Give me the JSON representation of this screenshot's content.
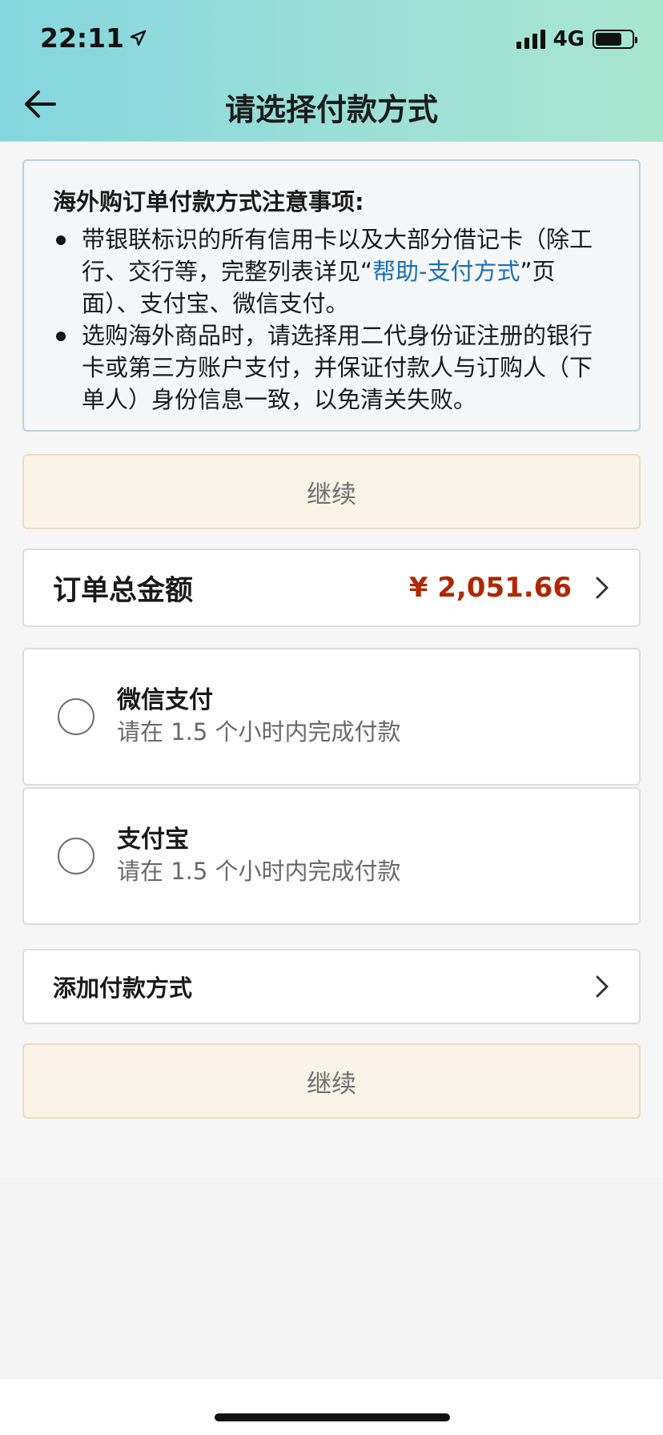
{
  "status_bar": {
    "time": "22:11",
    "network": "4G"
  },
  "header": {
    "title": "请选择付款方式"
  },
  "notice": {
    "title": "海外购订单付款方式注意事项:",
    "item1_before": "带银联标识的所有信用卡以及大部分借记卡（除工行、交行等，完整列表详见“",
    "item1_link": "帮助-支付方式",
    "item1_after": "”页面）、支付宝、微信支付。",
    "item2": "选购海外商品时，请选择用二代身份证注册的银行卡或第三方账户支付，并保证付款人与订购人（下单人）身份信息一致，以免清关失败。"
  },
  "continue_label": "继续",
  "order_total": {
    "label": "订单总金额",
    "amount": "¥  2,051.66"
  },
  "payment_options": [
    {
      "name": "微信支付",
      "note": "请在 1.5 个小时内完成付款"
    },
    {
      "name": "支付宝",
      "note": "请在 1.5 个小时内完成付款"
    }
  ],
  "add_payment": {
    "label": "添加付款方式"
  },
  "icons": {
    "back": "arrow-left-icon",
    "chevron": "chevron-right-icon",
    "location": "location-arrow-icon",
    "signal": "cellular-signal-icon",
    "battery": "battery-icon"
  },
  "colors": {
    "price": "#b12704",
    "link": "#1a6fb6",
    "button_bg": "#faf3e7"
  }
}
